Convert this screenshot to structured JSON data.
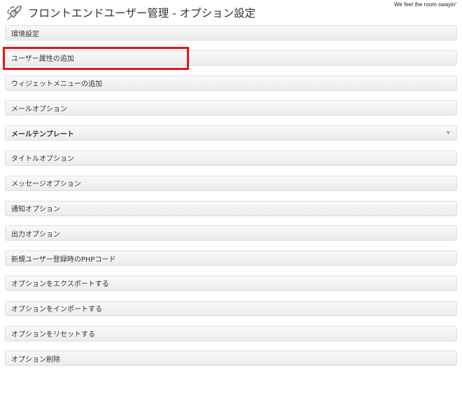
{
  "header": {
    "title": "フロントエンドユーザー管理 - オプション設定",
    "tagline": "We feel the room swayin'",
    "icon": "plugin-plug-icon"
  },
  "sections": [
    {
      "label": "環境設定"
    },
    {
      "label": "ユーザー属性の追加",
      "highlighted": true
    },
    {
      "label": "ウィジェットメニューの追加"
    },
    {
      "label": "メールオプション"
    },
    {
      "label": "メールテンプレート",
      "active": true,
      "toggle_icon": "chevron-down-icon"
    },
    {
      "label": "タイトルオプション"
    },
    {
      "label": "メッセージオプション"
    },
    {
      "label": "通知オプション"
    },
    {
      "label": "出力オプション"
    },
    {
      "label": "新規ユーザー登録時のPHPコード"
    },
    {
      "label": "オプションをエクスポートする"
    },
    {
      "label": "オプションをインポートする"
    },
    {
      "label": "オプションをリセットする"
    },
    {
      "label": "オプション削除"
    }
  ],
  "colors": {
    "highlight": "#e8141a",
    "panel_border": "#dfdfdf",
    "text": "#333333"
  },
  "toggle_glyph": "▼"
}
